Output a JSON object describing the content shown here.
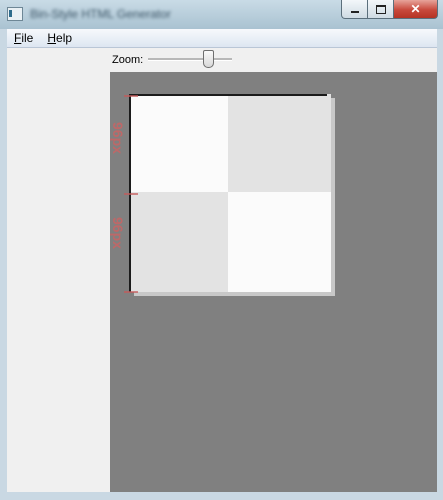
{
  "window": {
    "title": "Bin-Style HTML Generator",
    "buttons": {
      "minimize": "minimize",
      "maximize": "maximize",
      "close": "✕"
    }
  },
  "menu": {
    "items": [
      {
        "label": "File",
        "mnemonic": "F",
        "rest": "ile"
      },
      {
        "label": "Help",
        "mnemonic": "H",
        "rest": "elp"
      }
    ]
  },
  "toolbar": {
    "zoom_label": "Zoom:",
    "zoom_value": 0.75
  },
  "canvas": {
    "ruler_labels": [
      "96px",
      "96px"
    ],
    "colors": {
      "background": "#808080",
      "tile_light": "#fbfbfb",
      "tile_dark": "#e3e3e3",
      "ruler_label": "#c86464"
    }
  }
}
